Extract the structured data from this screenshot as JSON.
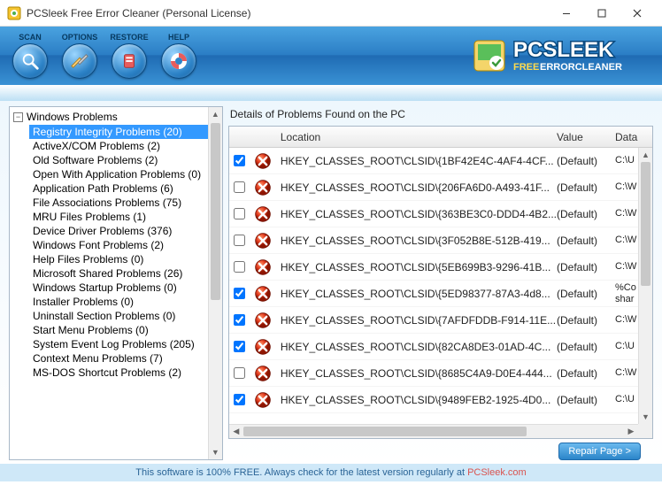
{
  "window": {
    "title": "PCSleek Free Error Cleaner (Personal License)"
  },
  "toolbar": {
    "scan": "SCAN",
    "options": "OPTIONS",
    "restore": "RESTORE",
    "help": "HELP"
  },
  "brand": {
    "name": "PCSLEEK",
    "sub1": "FREE",
    "sub2": "ERRORCLEANER"
  },
  "tree": {
    "root": "Windows Problems",
    "items": [
      {
        "label": "Registry Integrity Problems (20)",
        "selected": true
      },
      {
        "label": "ActiveX/COM Problems (2)"
      },
      {
        "label": "Old Software Problems (2)"
      },
      {
        "label": "Open With Application Problems (0)"
      },
      {
        "label": "Application Path Problems (6)"
      },
      {
        "label": "File Associations Problems (75)"
      },
      {
        "label": "MRU Files Problems (1)"
      },
      {
        "label": "Device Driver Problems (376)"
      },
      {
        "label": "Windows Font Problems (2)"
      },
      {
        "label": "Help Files Problems (0)"
      },
      {
        "label": "Microsoft Shared Problems (26)"
      },
      {
        "label": "Windows Startup Problems (0)"
      },
      {
        "label": "Installer Problems (0)"
      },
      {
        "label": "Uninstall Section Problems (0)"
      },
      {
        "label": "Start Menu Problems (0)"
      },
      {
        "label": "System Event Log Problems (205)"
      },
      {
        "label": "Context Menu Problems (7)"
      },
      {
        "label": "MS-DOS Shortcut Problems (2)"
      }
    ]
  },
  "details": {
    "title": "Details of Problems Found on the PC",
    "columns": {
      "location": "Location",
      "value": "Value",
      "data": "Data"
    },
    "rows": [
      {
        "checked": true,
        "location": "HKEY_CLASSES_ROOT\\CLSID\\{1BF42E4C-4AF4-4CF...",
        "value": "(Default)",
        "data": "C:\\U"
      },
      {
        "checked": false,
        "location": "HKEY_CLASSES_ROOT\\CLSID\\{206FA6D0-A493-41F...",
        "value": "(Default)",
        "data": "C:\\W"
      },
      {
        "checked": false,
        "location": "HKEY_CLASSES_ROOT\\CLSID\\{363BE3C0-DDD4-4B2...",
        "value": "(Default)",
        "data": "C:\\W"
      },
      {
        "checked": false,
        "location": "HKEY_CLASSES_ROOT\\CLSID\\{3F052B8E-512B-419...",
        "value": "(Default)",
        "data": "C:\\W"
      },
      {
        "checked": false,
        "location": "HKEY_CLASSES_ROOT\\CLSID\\{5EB699B3-9296-41B...",
        "value": "(Default)",
        "data": "C:\\W"
      },
      {
        "checked": true,
        "location": "HKEY_CLASSES_ROOT\\CLSID\\{5ED98377-87A3-4d8...",
        "value": "(Default)",
        "data": "%Co\nshar"
      },
      {
        "checked": true,
        "location": "HKEY_CLASSES_ROOT\\CLSID\\{7AFDFDDB-F914-11E...",
        "value": "(Default)",
        "data": "C:\\W"
      },
      {
        "checked": true,
        "location": "HKEY_CLASSES_ROOT\\CLSID\\{82CA8DE3-01AD-4C...",
        "value": "(Default)",
        "data": "C:\\U"
      },
      {
        "checked": false,
        "location": "HKEY_CLASSES_ROOT\\CLSID\\{8685C4A9-D0E4-444...",
        "value": "(Default)",
        "data": "C:\\W"
      },
      {
        "checked": true,
        "location": "HKEY_CLASSES_ROOT\\CLSID\\{9489FEB2-1925-4D0...",
        "value": "(Default)",
        "data": "C:\\U"
      }
    ]
  },
  "repair": {
    "label": "Repair Page >"
  },
  "footer": {
    "text1": "This software is 100% FREE. Always check for the latest version regularly at ",
    "brand": "PCSleek.com"
  }
}
